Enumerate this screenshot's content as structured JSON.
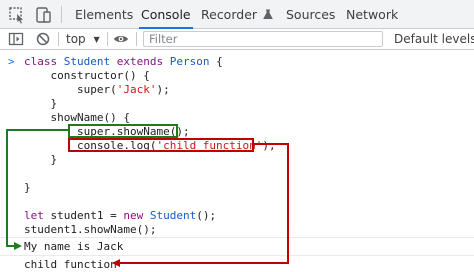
{
  "tabs": [
    {
      "label": "Elements",
      "active": false
    },
    {
      "label": "Console",
      "active": true
    },
    {
      "label": "Recorder",
      "active": false
    },
    {
      "label": "Sources",
      "active": false
    },
    {
      "label": "Network",
      "active": false
    }
  ],
  "toolbar": {
    "context": "top",
    "filter_placeholder": "Filter",
    "levels": "Default levels"
  },
  "code": [
    "class Student extends Person {",
    "    constructor() {",
    "        super('Jack');",
    "    }",
    "    showName() {",
    "        super.showName();",
    "        console.log('child function');",
    "    }",
    "",
    "}",
    "",
    "let student1 = new Student();",
    "student1.showName();"
  ],
  "outputs": [
    "My name is Jack",
    "child function"
  ],
  "colors": {
    "green": "#1f7a1f",
    "red": "#c00000",
    "accent": "#1a73e8"
  }
}
